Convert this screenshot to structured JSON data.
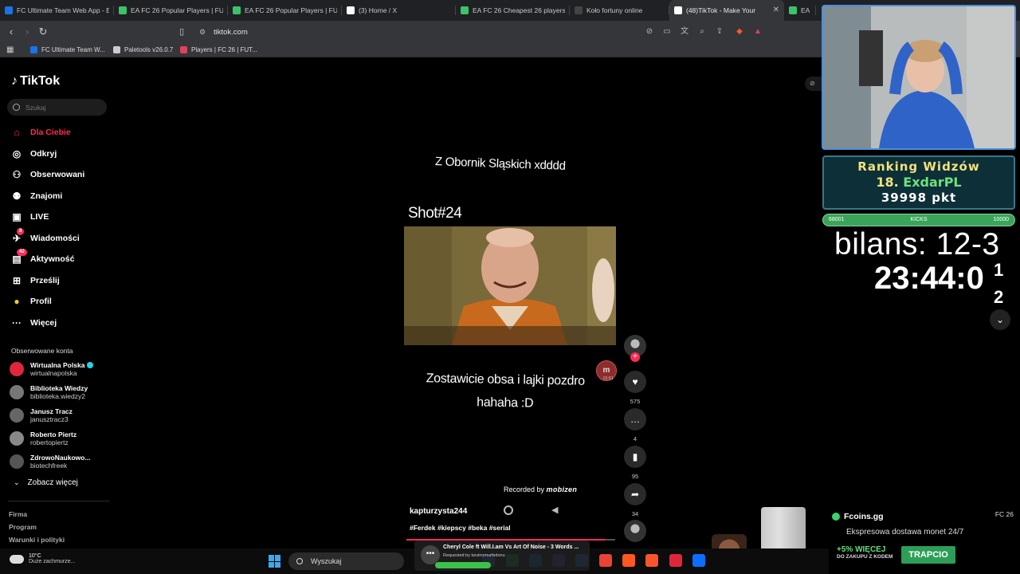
{
  "tabs": [
    {
      "title": "FC Ultimate Team Web App - E",
      "color": "#1a73e8"
    },
    {
      "title": "EA FC 26 Popular Players | FUT",
      "color": "#3cc36a"
    },
    {
      "title": "EA FC 26 Popular Players | FUT",
      "color": "#3cc36a"
    },
    {
      "title": "(3) Home / X",
      "color": "#ffffff"
    },
    {
      "title": "EA FC 26 Cheapest 26 players",
      "color": "#3cc36a"
    },
    {
      "title": "Koło fortuny online",
      "color": "#444444"
    },
    {
      "title": "(48)TikTok - Make Your",
      "color": "#ffffff",
      "active": true
    },
    {
      "title": "EA",
      "color": "#3cc36a"
    }
  ],
  "address": {
    "url": "tiktok.com"
  },
  "bookmarks": [
    {
      "label": "FC Ultimate Team W...",
      "color": "#1a73e8"
    },
    {
      "label": "Paletools v26.0.7",
      "color": "#cccccc"
    },
    {
      "label": "Players | FC 26 | FUT...",
      "color": "#e0425a"
    }
  ],
  "tiktok": {
    "logo": "TikTok",
    "search_placeholder": "Szukaj",
    "nav": [
      {
        "label": "Dla Ciebie",
        "icon": "home-icon",
        "active": true
      },
      {
        "label": "Odkryj",
        "icon": "compass-icon"
      },
      {
        "label": "Obserwowani",
        "icon": "following-icon"
      },
      {
        "label": "Znajomi",
        "icon": "friends-icon"
      },
      {
        "label": "LIVE",
        "icon": "live-icon"
      },
      {
        "label": "Wiadomości",
        "icon": "messages-icon",
        "badge": "8"
      },
      {
        "label": "Aktywność",
        "icon": "activity-icon",
        "badge": "42"
      },
      {
        "label": "Prześlij",
        "icon": "upload-icon"
      },
      {
        "label": "Profil",
        "icon": "profile-icon"
      },
      {
        "label": "Więcej",
        "icon": "more-icon"
      }
    ],
    "followed_title": "Obserwowane konta",
    "followed": [
      {
        "name": "Wirtualna Polska",
        "handle": "wirtualnapolska",
        "verified": true,
        "color": "#e0263c"
      },
      {
        "name": "Biblioteka Wiedzy",
        "handle": "biblioteka.wiedzy2",
        "color": "#777777"
      },
      {
        "name": "Janusz Tracz",
        "handle": "janusztracz3",
        "color": "#666666"
      },
      {
        "name": "Roberto Piertz",
        "handle": "robertopiertz",
        "color": "#888888"
      },
      {
        "name": "ZdrowoNaukowo...",
        "handle": "biotechfreek",
        "color": "#555555"
      }
    ],
    "see_more": "Zobacz więcej",
    "footer": [
      "Firma",
      "Program",
      "Warunki i polityki"
    ]
  },
  "video": {
    "caption_top": "Z Obornik Sląskich xdddd",
    "shot_label": "Shot#24",
    "caption_bottom": "Zostawicie obsa i lajki pozdro hahaha :D",
    "mobizen_badge": "m",
    "mobizen_time": "01:51",
    "recorded_prefix": "Recorded by",
    "recorded_brand": "mobizen",
    "author": "kapturzysta244",
    "hashtags": "#Ferdek #kiepscy #beka #serial",
    "progress": 0.95,
    "actions": {
      "likes": "575",
      "comments": "4",
      "saves": "95",
      "shares": "34"
    }
  },
  "stream": {
    "ranking_title": "Ranking Widzów",
    "ranking_rank": "18.",
    "ranking_name": "ExdarPL",
    "ranking_points": "39998 pkt",
    "kicks_left": "68001",
    "kicks_label": "KICKS",
    "kicks_right": "10000",
    "bilans": "bilans: 12-3",
    "clock": "23:44:0",
    "clock_side_1": "1",
    "clock_side_2": "2"
  },
  "fcoins": {
    "logo": "Fcoins.gg",
    "game": "FC 26",
    "tagline": "Ekspresowa dostawa monet 24/7",
    "promo": "+5% WIĘCEJ",
    "promo_sub": "DO ZAKUPU Z KODEM",
    "cta": "TRAPCIO"
  },
  "taskbar": {
    "temp": "10°C",
    "weather": "Duże zachmurze...",
    "search": "Wyszukaj",
    "media_title": "Cheryl Cole ft Will.I.am Vs Art Of Noise - 3 Words ...",
    "media_sub": "Requested by kevinomurfedonu",
    "apps": [
      "#3c6ee6",
      "#2f9e44",
      "#0078d4",
      "#7a3bd1",
      "#1e88e5",
      "#ea4335",
      "#ff5722",
      "#fb542b",
      "#e0263c",
      "#0d6efd"
    ]
  }
}
